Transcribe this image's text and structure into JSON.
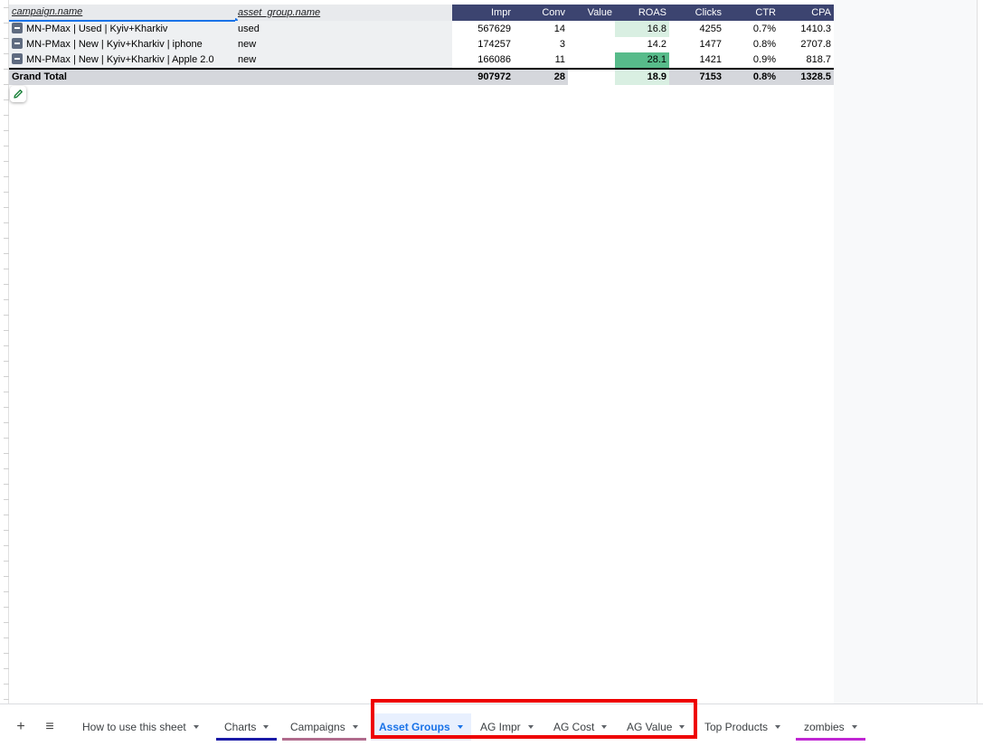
{
  "pivot": {
    "dimension_headers": [
      "campaign.name",
      "asset_group.name"
    ],
    "metric_headers": [
      "Impr",
      "Conv",
      "Value",
      "ROAS",
      "Clicks",
      "CTR",
      "CPA"
    ],
    "rows": [
      {
        "campaign": "MN-PMax | Used | Kyiv+Kharkiv",
        "asset_group": "used",
        "impr": "567629",
        "conv": "14",
        "value": "",
        "roas": "16.8",
        "clicks": "4255",
        "ctr": "0.7%",
        "cpa": "1410.3"
      },
      {
        "campaign": "MN-PMax | New | Kyiv+Kharkiv | iphone",
        "asset_group": "new",
        "impr": "174257",
        "conv": "3",
        "value": "",
        "roas": "14.2",
        "clicks": "1477",
        "ctr": "0.8%",
        "cpa": "2707.8"
      },
      {
        "campaign": "MN-PMax | New | Kyiv+Kharkiv | Apple 2.0",
        "asset_group": "new",
        "impr": "166086",
        "conv": "11",
        "value": "",
        "roas": "28.1",
        "clicks": "1421",
        "ctr": "0.9%",
        "cpa": "818.7"
      }
    ],
    "total": {
      "label": "Grand Total",
      "impr": "907972",
      "conv": "28",
      "value": "",
      "roas": "18.9",
      "clicks": "7153",
      "ctr": "0.8%",
      "cpa": "1328.5"
    }
  },
  "tabbar": {
    "add_icon": "+",
    "menu_icon": "≡",
    "tabs": [
      {
        "label": "How to use this sheet",
        "active": false,
        "color": ""
      },
      {
        "label": "Charts",
        "active": false,
        "color": "#1a1aa6"
      },
      {
        "label": "Campaigns",
        "active": false,
        "color": "#b06b8c"
      },
      {
        "label": "Asset Groups",
        "active": true,
        "color": ""
      },
      {
        "label": "AG Impr",
        "active": false,
        "color": ""
      },
      {
        "label": "AG Cost",
        "active": false,
        "color": ""
      },
      {
        "label": "AG Value",
        "active": false,
        "color": ""
      },
      {
        "label": "Top Products",
        "active": false,
        "color": ""
      },
      {
        "label": "zombies",
        "active": false,
        "color": "#c026d3"
      }
    ]
  },
  "colors": {
    "header_dark": "#3c4470",
    "roas_high": "#57bb8a",
    "roas_low": "#d9efe2",
    "active_tab": "#1a73e8",
    "highlight": "#ee0000"
  }
}
